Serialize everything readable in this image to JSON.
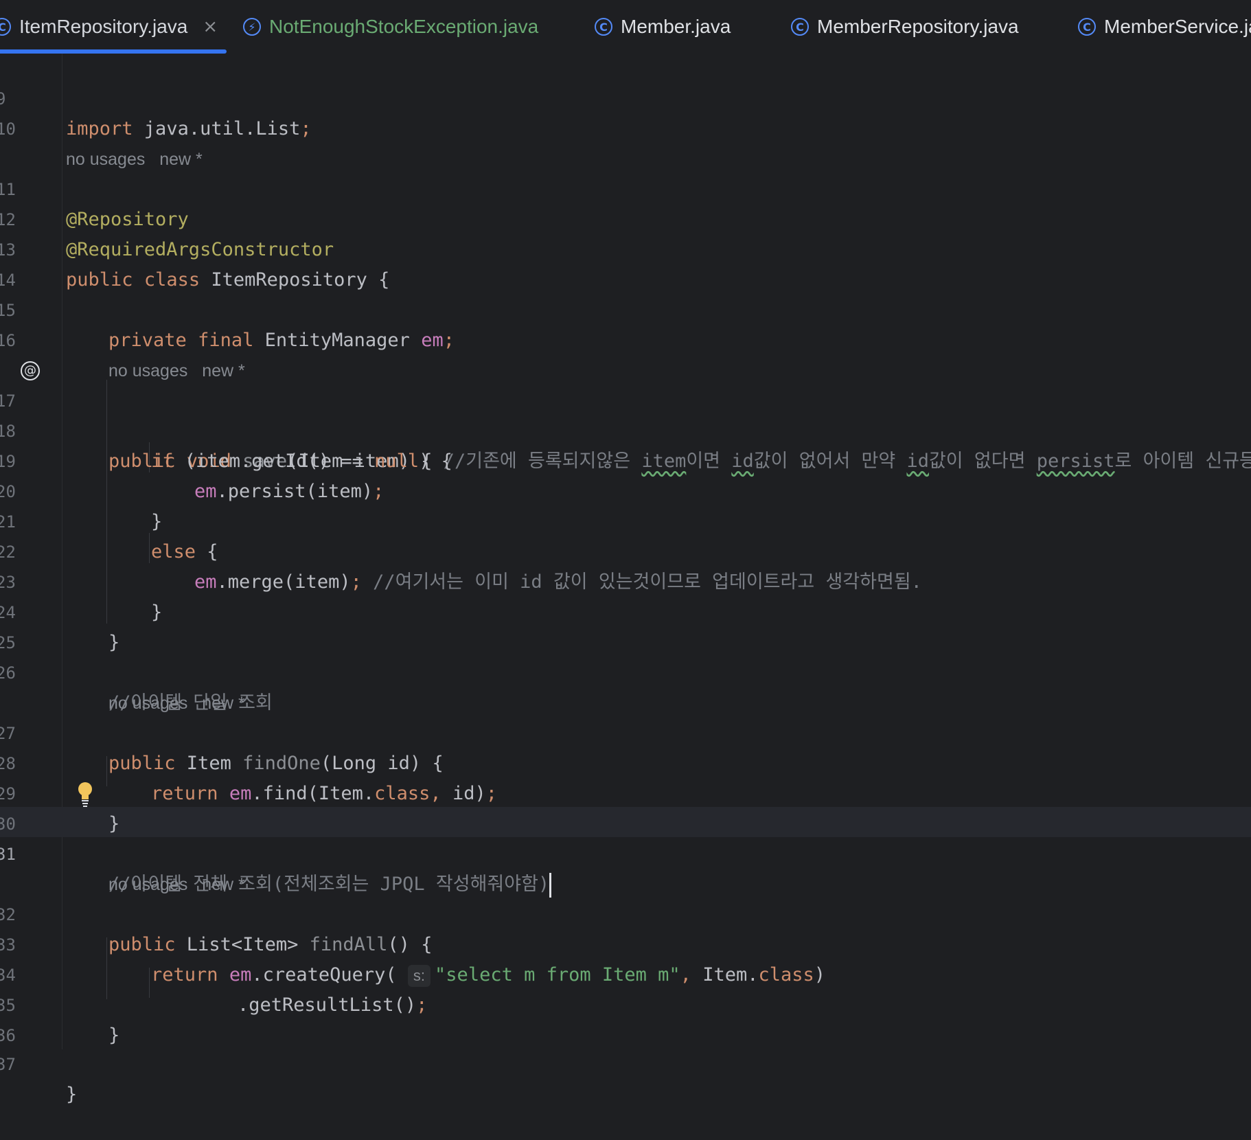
{
  "tabs": [
    {
      "label": "ItemRepository.java",
      "icon": "class-icon",
      "active": true
    },
    {
      "label": "NotEnoughStockException.java",
      "icon": "exception-icon"
    },
    {
      "label": "Member.java",
      "icon": "class-icon"
    },
    {
      "label": "MemberRepository.java",
      "icon": "class-icon"
    },
    {
      "label": "MemberService.ja",
      "icon": "class-icon"
    }
  ],
  "tab_close": "×",
  "class_icon_glyph": "C",
  "exception_icon_glyph": "⚡",
  "hints": {
    "no_usages": "no usages",
    "new": "new *"
  },
  "line_numbers": {
    "l9": "9",
    "l10": "10",
    "l11": "11",
    "l12": "12",
    "l13": "13",
    "l14": "14",
    "l15": "15",
    "l16": "16",
    "l17": "17",
    "l18": "18",
    "l19": "19",
    "l20": "20",
    "l21": "21",
    "l22": "22",
    "l23": "23",
    "l24": "24",
    "l25": "25",
    "l26": "26",
    "l27": "27",
    "l28": "28",
    "l29": "29",
    "l30": "30",
    "l31": "31",
    "l32": "32",
    "l33": "33",
    "l34": "34",
    "l35": "35",
    "l36": "36",
    "l37": "37"
  },
  "code": {
    "import_kw": "import",
    "import_path": " java.util.List",
    "semi": ";",
    "ann_repository": "@Repository",
    "ann_rac": "@RequiredArgsConstructor",
    "public": "public",
    "class": "class",
    "class_name": " ItemRepository {",
    "private": "private",
    "final": "final",
    "entity_manager": " EntityManager ",
    "em": "em",
    "void": "void",
    "save": "save",
    "save_params": "(Item item) { ",
    "save_comment_1": "//기존에 등록되지않은 ",
    "save_comment_item": "item",
    "save_comment_2": "이면 ",
    "save_comment_id1": "id",
    "save_comment_3": "값이 없어서 만약 ",
    "save_comment_id2": "id",
    "save_comment_4": "값이 없다면 ",
    "save_comment_persist": "persist",
    "save_comment_5": "로 아이템 신규등록",
    "if": "if",
    "if_cond_1": " (item.getId() == ",
    "null": "null",
    "if_cond_2": ") {",
    "persist_call": ".persist(item)",
    "close_brace": "}",
    "else": "else",
    "else_open": " {",
    "merge_call": ".merge(item)",
    "merge_comment": " //여기서는 이미 id 값이 있는것이므로 업데이트라고 생각하면됨.",
    "comment_findone": "//아이템 단일 조회",
    "item_type": " Item ",
    "findone": "findOne",
    "findone_params": "(Long id) {",
    "return": "return",
    "find_call": ".find(Item.",
    "comma": ", ",
    "find_end": "id)",
    "comment_findall": "//아이템 전체 조회(전체조회는 JPQL 작성해줘야함)",
    "list_type": " List<Item> ",
    "findall": "findAll",
    "findall_params": "() {",
    "create_query": ".createQuery(",
    "param_hint": "s:",
    "query_string": "\"select m from Item m\"",
    "item_class": "Item.",
    "close_paren": ")",
    "get_result": ".getResultList()"
  }
}
